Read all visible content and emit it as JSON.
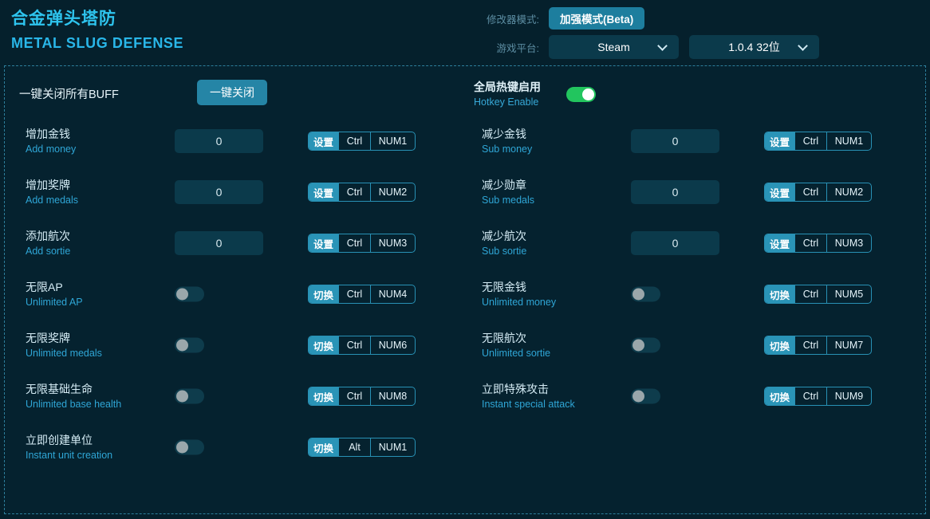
{
  "header": {
    "title_cn": "合金弹头塔防",
    "title_en": "METAL SLUG DEFENSE",
    "mode_label": "修改器模式:",
    "mode_button": "加强模式(Beta)",
    "platform_label": "游戏平台:",
    "platform_value": "Steam",
    "version_value": "1.0.4 32位"
  },
  "colors": {
    "page_bg": "#05202c",
    "panel_bg": "#05222f",
    "accent_cyan": "#2ec4ee",
    "accent_teal": "#2a94b7",
    "toggle_on": "#22c55e",
    "toggle_off_track": "#0e3c4c",
    "toggle_knob": "#9aa7ab",
    "input_bg": "#0b3a4b",
    "border_dashed": "#2d7f9c"
  },
  "utility": {
    "buff_label": "一键关闭所有BUFF",
    "buff_button": "一键关闭",
    "hotkey_cn": "全局热键启用",
    "hotkey_en": "Hotkey Enable",
    "hotkey_state": "on"
  },
  "left_rows": [
    {
      "cn": "增加金钱",
      "en": "Add money",
      "control": "input",
      "value": "0",
      "action": "设置",
      "mod": "Ctrl",
      "key": "NUM1"
    },
    {
      "cn": "增加奖牌",
      "en": "Add medals",
      "control": "input",
      "value": "0",
      "action": "设置",
      "mod": "Ctrl",
      "key": "NUM2"
    },
    {
      "cn": "添加航次",
      "en": "Add sortie",
      "control": "input",
      "value": "0",
      "action": "设置",
      "mod": "Ctrl",
      "key": "NUM3"
    },
    {
      "cn": "无限AP",
      "en": "Unlimited AP",
      "control": "toggle",
      "value": "off",
      "action": "切换",
      "mod": "Ctrl",
      "key": "NUM4"
    },
    {
      "cn": "无限奖牌",
      "en": "Unlimited medals",
      "control": "toggle",
      "value": "off",
      "action": "切换",
      "mod": "Ctrl",
      "key": "NUM6"
    },
    {
      "cn": "无限基础生命",
      "en": "Unlimited base health",
      "control": "toggle",
      "value": "off",
      "action": "切换",
      "mod": "Ctrl",
      "key": "NUM8"
    },
    {
      "cn": "立即创建单位",
      "en": "Instant unit creation",
      "control": "toggle",
      "value": "off",
      "action": "切换",
      "mod": "Alt",
      "key": "NUM1"
    }
  ],
  "right_rows": [
    {
      "cn": "减少金钱",
      "en": "Sub money",
      "control": "input",
      "value": "0",
      "action": "设置",
      "mod": "Ctrl",
      "key": "NUM1"
    },
    {
      "cn": "减少勋章",
      "en": "Sub medals",
      "control": "input",
      "value": "0",
      "action": "设置",
      "mod": "Ctrl",
      "key": "NUM2"
    },
    {
      "cn": "减少航次",
      "en": "Sub sortie",
      "control": "input",
      "value": "0",
      "action": "设置",
      "mod": "Ctrl",
      "key": "NUM3"
    },
    {
      "cn": "无限金钱",
      "en": "Unlimited money",
      "control": "toggle",
      "value": "off",
      "action": "切换",
      "mod": "Ctrl",
      "key": "NUM5"
    },
    {
      "cn": "无限航次",
      "en": "Unlimited sortie",
      "control": "toggle",
      "value": "off",
      "action": "切换",
      "mod": "Ctrl",
      "key": "NUM7"
    },
    {
      "cn": "立即特殊攻击",
      "en": "Instant special attack",
      "control": "toggle",
      "value": "off",
      "action": "切换",
      "mod": "Ctrl",
      "key": "NUM9"
    }
  ]
}
